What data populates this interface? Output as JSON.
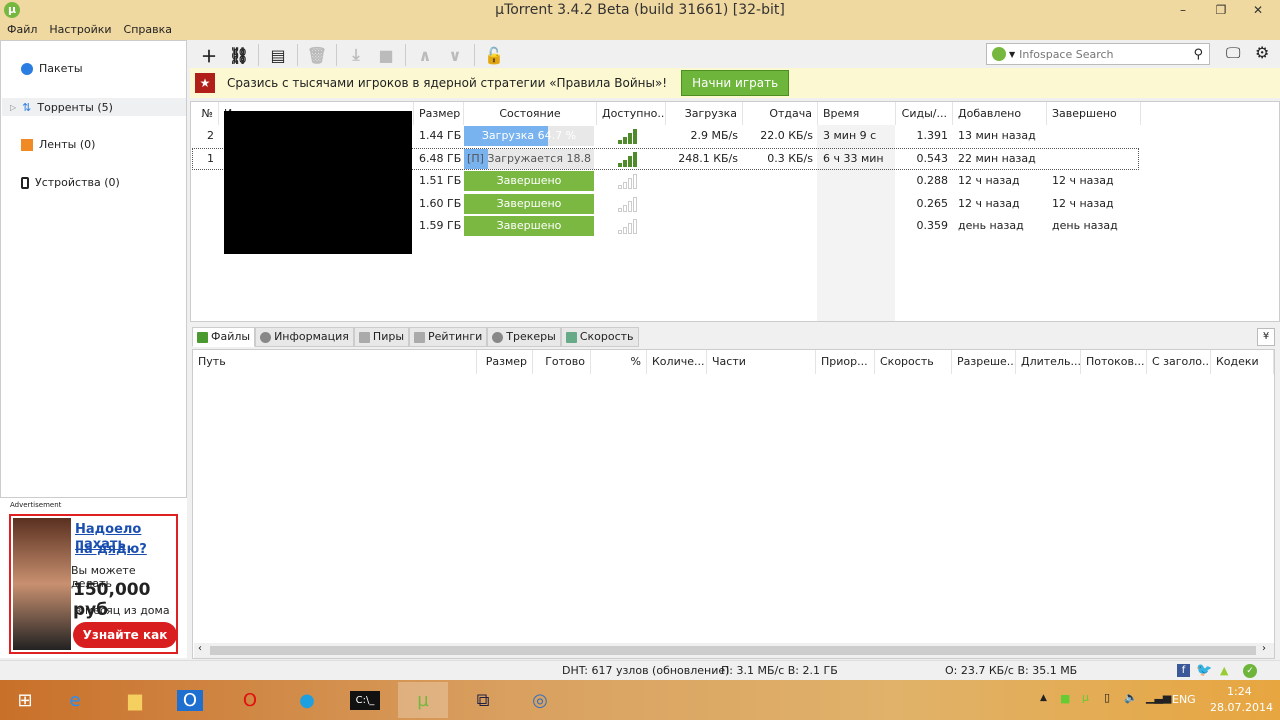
{
  "window": {
    "title": "µTorrent 3.4.2 Beta (build 31661) [32-bit]",
    "min": "–",
    "restore": "❐",
    "close": "✕"
  },
  "menu": [
    "Файл",
    "Настройки",
    "Справка"
  ],
  "sidebar": {
    "items": [
      {
        "label": "Пакеты",
        "icon": "bundle-icon"
      },
      {
        "label": "Торренты (5)",
        "icon": "torrents-icon"
      },
      {
        "label": "Ленты (0)",
        "icon": "rss-icon"
      },
      {
        "label": "Устройства (0)",
        "icon": "device-icon"
      }
    ]
  },
  "ad": {
    "label": "Advertisement",
    "line1": "Надоело пахать",
    "line2": "на дядю?",
    "line3": "Вы можете делать",
    "amount": "150,000 руб",
    "line4": "в месяц из дома",
    "cta": "Узнайте как"
  },
  "search": {
    "placeholder": "Infospace Search"
  },
  "banner": {
    "text": "Сразись с тысячами игроков в ядерной стратегии «Правила Войны»!",
    "button": "Начни играть"
  },
  "torrents": {
    "columns": [
      "№",
      "Имя",
      "Размер",
      "Состояние",
      "Доступно...",
      "Загрузка",
      "Отдача",
      "Время",
      "Сиды/...",
      "Добавлено",
      "Завершено"
    ],
    "rows": [
      {
        "num": "2",
        "size": "1.44 ГБ",
        "status": "Загрузка 64.7 %",
        "progress": 64.7,
        "done": false,
        "avail": true,
        "down": "2.9 МБ/s",
        "up": "22.0 КБ/s",
        "time": "3 мин 9 с",
        "ratio": "1.391",
        "added": "13 мин назад",
        "completed": ""
      },
      {
        "num": "1",
        "size": "6.48 ГБ",
        "status": "[П] Загружается 18.8 %",
        "progress": 18.8,
        "done": false,
        "avail": true,
        "down": "248.1 КБ/s",
        "up": "0.3 КБ/s",
        "time": "6 ч 33 мин",
        "ratio": "0.543",
        "added": "22 мин назад",
        "completed": ""
      },
      {
        "num": "",
        "size": "1.51 ГБ",
        "status": "Завершено",
        "progress": 100,
        "done": true,
        "avail": false,
        "down": "",
        "up": "",
        "time": "",
        "ratio": "0.288",
        "added": "12 ч назад",
        "completed": "12 ч назад"
      },
      {
        "num": "",
        "size": "1.60 ГБ",
        "status": "Завершено",
        "progress": 100,
        "done": true,
        "avail": false,
        "down": "",
        "up": "",
        "time": "",
        "ratio": "0.265",
        "added": "12 ч назад",
        "completed": "12 ч назад"
      },
      {
        "num": "",
        "size": "1.59 ГБ",
        "status": "Завершено",
        "progress": 100,
        "done": true,
        "avail": false,
        "down": "",
        "up": "",
        "time": "",
        "ratio": "0.359",
        "added": "день назад",
        "completed": "день назад"
      }
    ]
  },
  "tabs": [
    "Файлы",
    "Информация",
    "Пиры",
    "Рейтинги",
    "Трекеры",
    "Скорость"
  ],
  "files": {
    "columns": [
      "Путь",
      "Размер",
      "Готово",
      "%",
      "Количе...",
      "Части",
      "Приор...",
      "Скорость",
      "Разреше...",
      "Длитель...",
      "Потоков...",
      "С заголо...",
      "Кодеки"
    ]
  },
  "status": {
    "dht": "DHT: 617 узлов  (обновление)",
    "down": "П: 3.1 МБ/с В: 2.1 ГБ",
    "up": "О: 23.7 КБ/с В: 35.1 МБ"
  },
  "tray": {
    "lang": "ENG",
    "time": "1:24",
    "date": "28.07.2014"
  },
  "colors": {
    "accent": "#7ab842",
    "progress": "#79b3ef",
    "titlebar": "#f0d9a0"
  }
}
